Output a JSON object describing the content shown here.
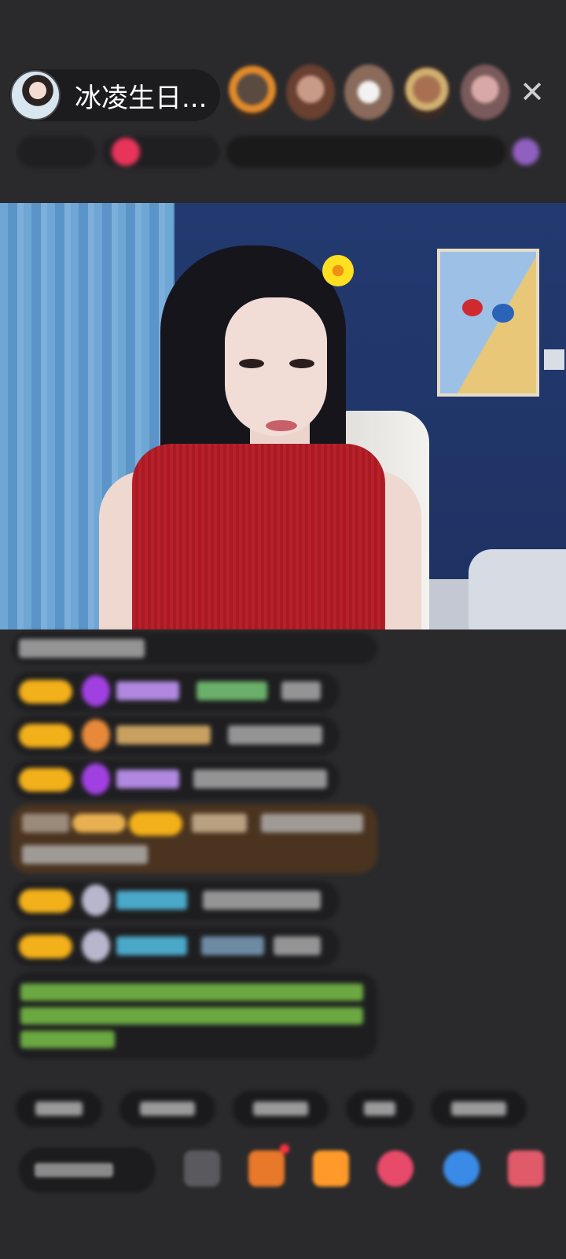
{
  "header": {
    "host_name": "冰凌生日...",
    "close_glyph": "✕",
    "viewer_count": 5
  },
  "colors": {
    "background": "#2a2a2c",
    "level_badge": "#f2b01a",
    "notice_text": "#7ecb4a",
    "gift_message_bg": "#4a3420"
  },
  "icons": {
    "close": "close-icon",
    "emoji": "emoji-icon",
    "gift_box": "gift-box-icon",
    "gift": "gift-icon",
    "like": "heart-icon",
    "chat": "chat-bubble-icon",
    "more": "grid-icon"
  }
}
